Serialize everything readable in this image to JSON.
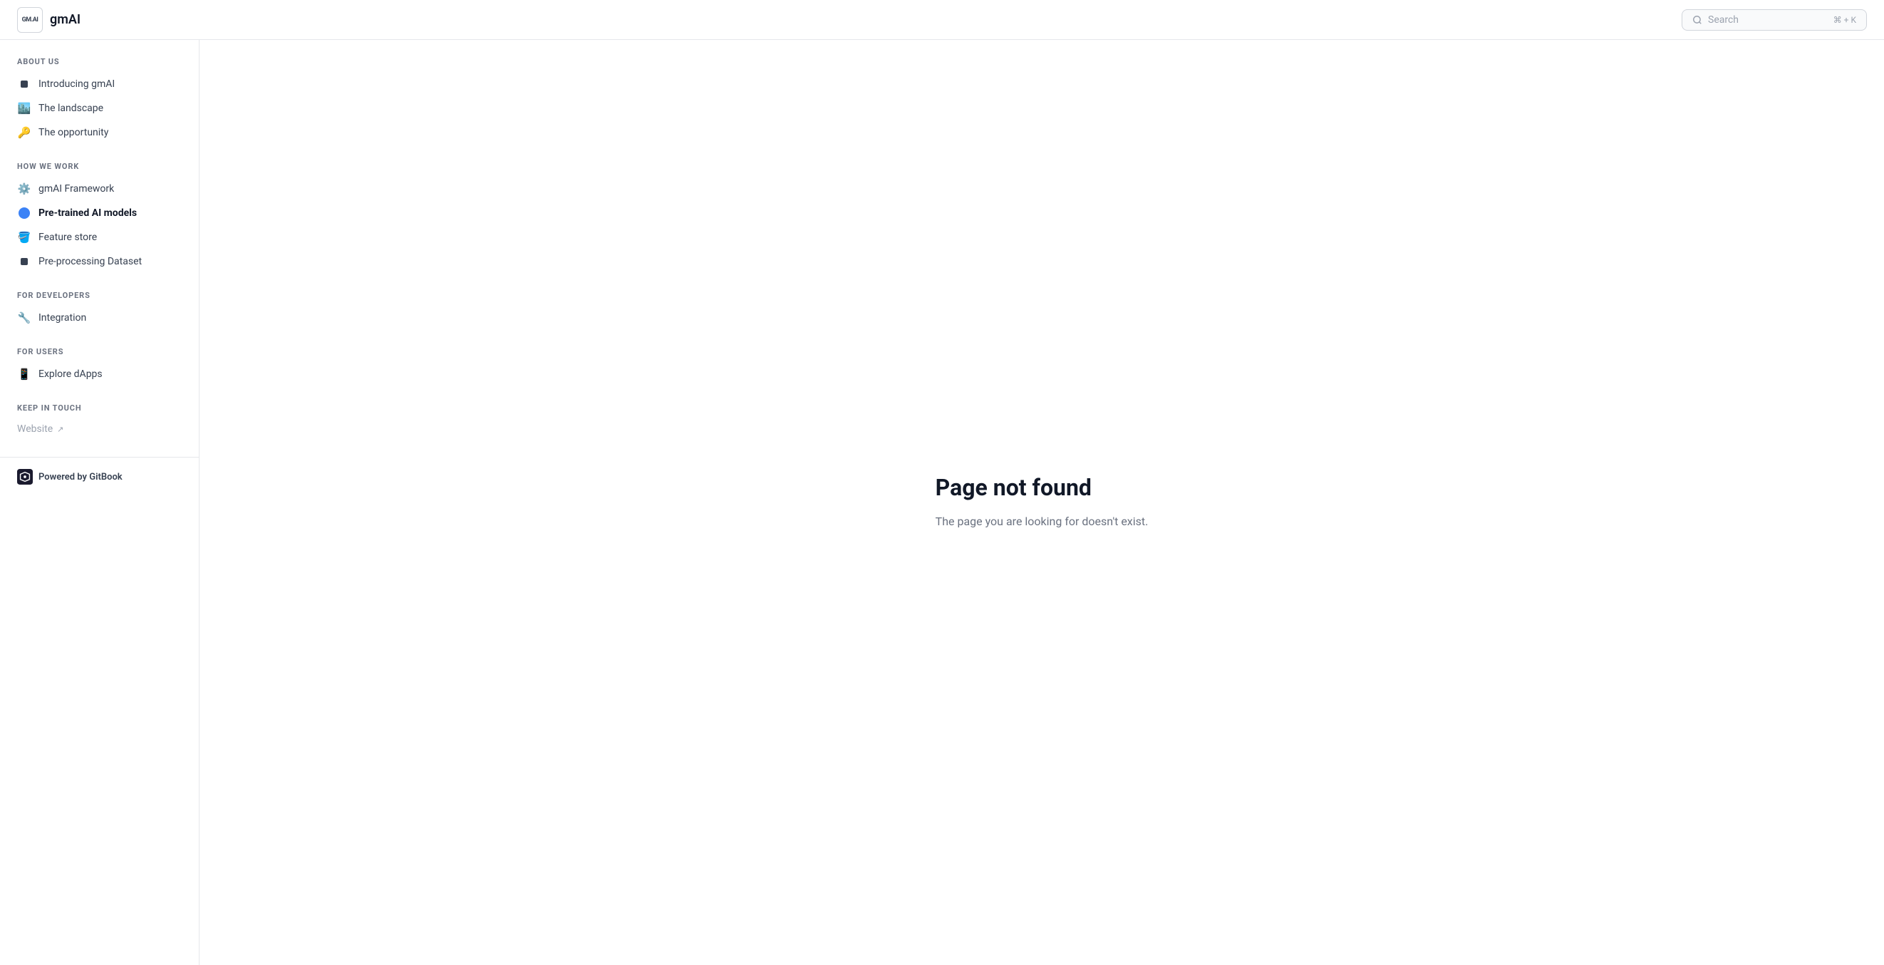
{
  "header": {
    "logo_badge": "GM.AI",
    "logo_text": "gmAI",
    "search_placeholder": "Search",
    "search_shortcut": "⌘ + K"
  },
  "sidebar": {
    "sections": [
      {
        "id": "about-us",
        "title": "ABOUT US",
        "items": [
          {
            "id": "introducing",
            "label": "Introducing gmAI",
            "icon": "square",
            "active": false
          },
          {
            "id": "landscape",
            "label": "The landscape",
            "icon": "🏙️",
            "active": false
          },
          {
            "id": "opportunity",
            "label": "The opportunity",
            "icon": "🔑",
            "active": false
          }
        ]
      },
      {
        "id": "how-we-work",
        "title": "HOW WE WORK",
        "items": [
          {
            "id": "framework",
            "label": "gmAI Framework",
            "icon": "⚙️",
            "active": false
          },
          {
            "id": "pretrained",
            "label": "Pre-trained AI models",
            "icon": "circle-blue",
            "active": true
          },
          {
            "id": "feature-store",
            "label": "Feature store",
            "icon": "🪣",
            "active": false
          },
          {
            "id": "preprocessing",
            "label": "Pre-processing Dataset",
            "icon": "square",
            "active": false
          }
        ]
      },
      {
        "id": "for-developers",
        "title": "FOR DEVELOPERS",
        "items": [
          {
            "id": "integration",
            "label": "Integration",
            "icon": "🔧",
            "active": false
          }
        ]
      },
      {
        "id": "for-users",
        "title": "FOR USERS",
        "items": [
          {
            "id": "dapps",
            "label": "Explore dApps",
            "icon": "📱",
            "active": false
          }
        ]
      },
      {
        "id": "keep-in-touch",
        "title": "KEEP IN TOUCH",
        "items": []
      }
    ],
    "website_link": "Website",
    "footer_label": "Powered by GitBook"
  },
  "main": {
    "not_found_title": "Page not found",
    "not_found_description": "The page you are looking for doesn't exist."
  }
}
